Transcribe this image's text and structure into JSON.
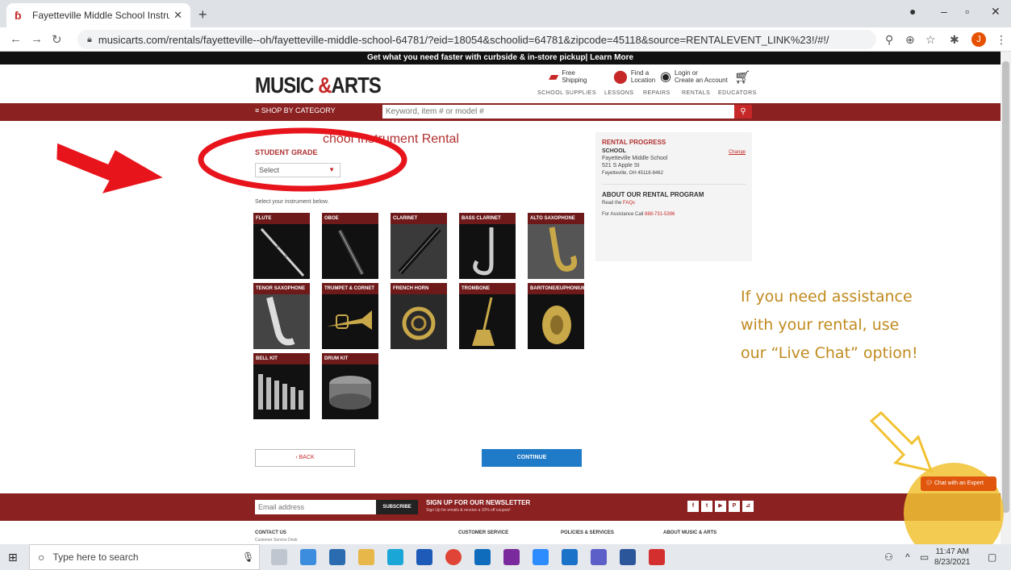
{
  "browser": {
    "tab_title": "Fayetteville Middle School Instrum",
    "url": "musicarts.com/rentals/fayetteville--oh/fayetteville-middle-school-64781/?eid=18054&schoolid=64781&zipcode=45118&source=RENTALEVENT_LINK%23!/#!/",
    "profile_initial": "J"
  },
  "site": {
    "promo": "Get what you need faster with curbside & in-store pickup| Learn More",
    "logo_main": "MUSIC ",
    "logo_amp": "&",
    "logo_tail": "ARTS",
    "utility": {
      "shipping_l1": "Free",
      "shipping_l2": "Shipping",
      "location_l1": "Find a",
      "location_l2": "Location",
      "login_l1": "Login or",
      "login_l2": "Create an Account"
    },
    "subnav": [
      "SCHOOL SUPPLIES",
      "LESSONS",
      "REPAIRS",
      "RENTALS",
      "EDUCATORS"
    ],
    "shop_category": "≡ SHOP BY CATEGORY",
    "search_placeholder": "Keyword, item # or model #"
  },
  "main": {
    "title_visible": "chool Instrument Rental",
    "student_grade_label": "STUDENT GRADE",
    "grade_select_value": "Select",
    "instrument_prompt": "Select your instrument below.",
    "instruments": [
      {
        "label": "FLUTE"
      },
      {
        "label": "OBOE"
      },
      {
        "label": "CLARINET"
      },
      {
        "label": "BASS CLARINET"
      },
      {
        "label": "ALTO SAXOPHONE"
      },
      {
        "label": "TENOR SAXOPHONE"
      },
      {
        "label": "TRUMPET & CORNET"
      },
      {
        "label": "FRENCH HORN"
      },
      {
        "label": "TROMBONE"
      },
      {
        "label": "BARITONE/EUPHONIUM"
      },
      {
        "label": "BELL KIT"
      },
      {
        "label": "DRUM KIT"
      }
    ],
    "back_label": "‹ BACK",
    "continue_label": "CONTINUE"
  },
  "progress": {
    "title": "RENTAL PROGRESS",
    "school_heading": "SCHOOL",
    "change_link": "Change",
    "school_name": "Fayetteville Middle School",
    "address1": "521 S Apple St",
    "address2": "Fayetteville, OH 45118-8462",
    "about_title": "ABOUT OUR RENTAL PROGRAM",
    "read_faqs_prefix": "Read the ",
    "read_faqs_link": "FAQs",
    "assist_prefix": "For Assistance Call ",
    "assist_phone": "888-731-5396"
  },
  "annotation": {
    "line1": "If you need assistance",
    "line2": "with your rental, use",
    "line3": "our “Live Chat” option!",
    "colors": {
      "red_arrow": "#e8141c",
      "yellow_arrow": "#f1c232",
      "text": "#c08a1e"
    }
  },
  "footer": {
    "email_placeholder": "Email address",
    "subscribe_label": "SUBSCRIBE",
    "newsletter_title": "SIGN UP FOR OUR NEWSLETTER",
    "newsletter_sub": "Sign Up for emails & receive a 10% off coupon!",
    "social": [
      "f",
      "t",
      "▶",
      "P",
      "⊿"
    ],
    "columns": [
      "CONTACT US",
      "CUSTOMER SERVICE",
      "POLICIES & SERVICES",
      "ABOUT MUSIC & ARTS"
    ],
    "contact_sub": "Customer Service Desk",
    "chat_label": "Chat with an Expert"
  },
  "taskbar": {
    "search_placeholder": "Type here to search",
    "time": "11:47 AM",
    "date": "8/23/2021"
  },
  "colors": {
    "brand_red": "#8b2121",
    "accent_red": "#c62828",
    "continue_blue": "#1f7ac7",
    "chat_orange": "#e0560d"
  }
}
